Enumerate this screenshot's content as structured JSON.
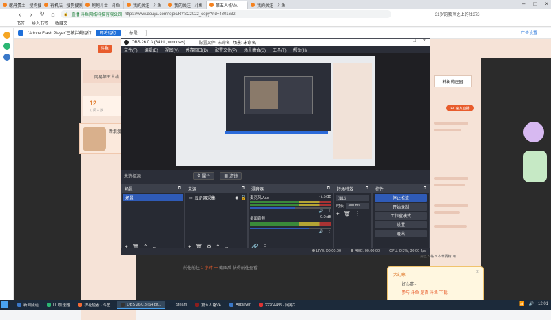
{
  "browser": {
    "tabs": [
      {
        "label": "螺丹贵土 · 搜狗搜索",
        "active": false
      },
      {
        "label": "有机法 · 搜狗搜索",
        "active": false
      },
      {
        "label": "鲍鲍斗士 · 斗鱼",
        "active": false
      },
      {
        "label": "我的关注 · 斗鱼",
        "active": false
      },
      {
        "label": "我的关注 · 斗鱼",
        "active": false
      },
      {
        "label": "第五人格VA",
        "active": true
      },
      {
        "label": "我的关注 · 斗鱼",
        "active": false
      }
    ],
    "url_site": "直播 斗鱼网络科技有限公司",
    "url_path": "https://www.douyu.com/topic/RYSC2022_copy?rid=4801632",
    "url_right": "31岁的教师之上的杜373+",
    "bookmarks": [
      "书签",
      "导入书签",
      "收藏夹"
    ],
    "flash_message": "\"Adobe Flash Player\"已被拦截运行",
    "flash_allow": "即将运行",
    "flash_ignore": "总是 ...",
    "flash_manage": "广告设置"
  },
  "page": {
    "site_logo": "斗鱼",
    "left_banner": "网易第五人格",
    "stat_number": "12",
    "stat_sub": "订阅人数",
    "anime_title": "新浪漫",
    "right_title": "韩树的庄园",
    "right_button": "PC官方直播",
    "right_bottom": "第五人格 8 本木赛精 用",
    "bottom_text_pre": "前往前往",
    "bottom_text_hl": "1 小时 一",
    "bottom_text_post": "截图后 获得前往查看",
    "popup_title": "大幻象",
    "popup_line1": "好心赛~",
    "popup_line2": "参与 斗鱼 是否 斗鱼 下载"
  },
  "obs": {
    "title": "OBS 26.0.3 (64 bit, windows)",
    "title_profile": "配置文件: 未命名",
    "title_scene": "场景: 未命名",
    "menu": [
      "文件(F)",
      "编辑(E)",
      "视图(V)",
      "停靠窗口(D)",
      "配置文件(P)",
      "场景集合(S)",
      "工具(T)",
      "帮助(H)"
    ],
    "toolbar_label": "未选择源",
    "toolbar_props": "属性",
    "toolbar_filters": "滤镜",
    "docks": {
      "scenes": {
        "title": "场景",
        "items": [
          "场景"
        ]
      },
      "sources": {
        "title": "来源",
        "items": [
          "显示器采集"
        ]
      },
      "mixer": {
        "title": "混音器",
        "channels": [
          {
            "name": "麦克风/Aux",
            "db": "-7.5 dB",
            "level": 0.55
          },
          {
            "name": "桌面音频",
            "db": "0.0 dB",
            "level": 0.72
          }
        ]
      },
      "transitions": {
        "title": "转场特效",
        "type": "淡出",
        "duration_label": "时长",
        "duration": "300 ms"
      },
      "controls": {
        "title": "控件",
        "buttons": [
          "停止推流",
          "开始录制",
          "工作室模式",
          "设置",
          "退出"
        ]
      }
    },
    "status": {
      "live": "LIVE: 00:00:00",
      "rec": "REC: 00:00:00",
      "cpu": "CPU: 0.3%, 30.00 fps"
    }
  },
  "taskbar": {
    "items": [
      {
        "label": "新闻频道",
        "active": false,
        "color": "#3a78c9"
      },
      {
        "label": "UU加速器",
        "active": false,
        "color": "#2bb673"
      },
      {
        "label": "护花使者 · 斗鱼..",
        "active": false,
        "color": "#f06a35"
      },
      {
        "label": "OBS 26.0.3 (64 bit...",
        "active": true,
        "color": "#333333"
      },
      {
        "label": "Steam",
        "active": false,
        "color": "#1b2838"
      },
      {
        "label": "第五人格VA",
        "active": false,
        "color": "#8b1e1e"
      },
      {
        "label": "Airplayer",
        "active": false,
        "color": "#3a78c9"
      },
      {
        "label": "22204485 · 网易G...",
        "active": false,
        "color": "#d33"
      }
    ],
    "clock": "12:01"
  },
  "colors": {
    "obs_accent": "#2f5bb7",
    "brand": "#e85c2c"
  }
}
